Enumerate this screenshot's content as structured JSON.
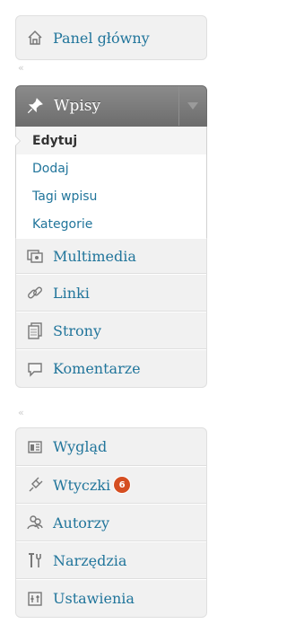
{
  "menu": {
    "dashboard": {
      "label": "Panel główny",
      "icon": "home-icon"
    },
    "posts": {
      "label": "Wpisy",
      "icon": "pin-icon",
      "submenu": [
        "Edytuj",
        "Dodaj",
        "Tagi wpisu",
        "Kategorie"
      ],
      "current": "Edytuj"
    },
    "content_group": [
      {
        "label": "Multimedia",
        "icon": "media-icon"
      },
      {
        "label": "Linki",
        "icon": "link-icon"
      },
      {
        "label": "Strony",
        "icon": "pages-icon"
      },
      {
        "label": "Komentarze",
        "icon": "comment-icon"
      }
    ],
    "admin_group": [
      {
        "label": "Wygląd",
        "icon": "appearance-icon"
      },
      {
        "label": "Wtyczki",
        "icon": "plugin-icon",
        "badge": "6"
      },
      {
        "label": "Autorzy",
        "icon": "users-icon"
      },
      {
        "label": "Narzędzia",
        "icon": "tools-icon"
      },
      {
        "label": "Ustawienia",
        "icon": "settings-icon"
      }
    ],
    "separator_glyph": "«",
    "colors": {
      "link": "#21759b",
      "open_header": "#7a7a7a",
      "badge": "#d54e21"
    }
  }
}
